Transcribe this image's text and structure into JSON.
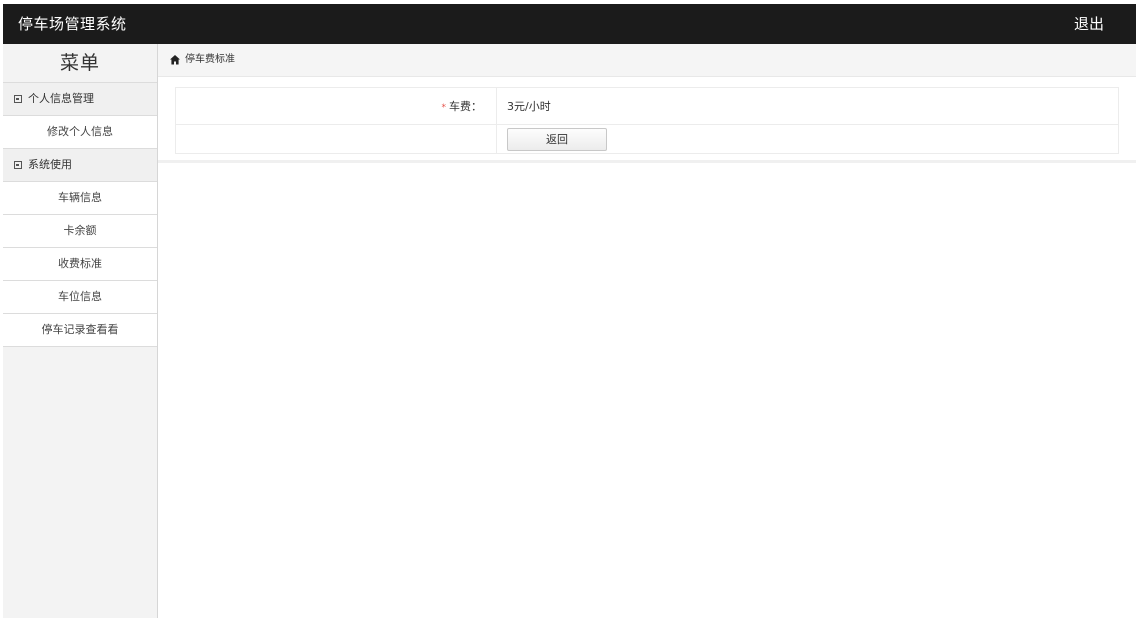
{
  "header": {
    "app_title": "停车场管理系统",
    "logout_label": "退出"
  },
  "sidebar": {
    "title": "菜单",
    "groups": [
      {
        "label": "个人信息管理",
        "items": [
          {
            "label": "修改个人信息"
          }
        ]
      },
      {
        "label": "系统使用",
        "items": [
          {
            "label": "车辆信息"
          },
          {
            "label": "卡余额"
          },
          {
            "label": "收费标准"
          },
          {
            "label": "车位信息"
          },
          {
            "label": "停车记录查看看"
          }
        ]
      }
    ]
  },
  "breadcrumb": {
    "icon": "home-icon",
    "label": "停车费标准"
  },
  "form": {
    "fee_label": "车费：",
    "required_mark": "*",
    "fee_value": "3元/小时",
    "back_button": "返回"
  },
  "colors": {
    "topbar_bg": "#1b1b1b",
    "required_mark": "#e5534b"
  }
}
